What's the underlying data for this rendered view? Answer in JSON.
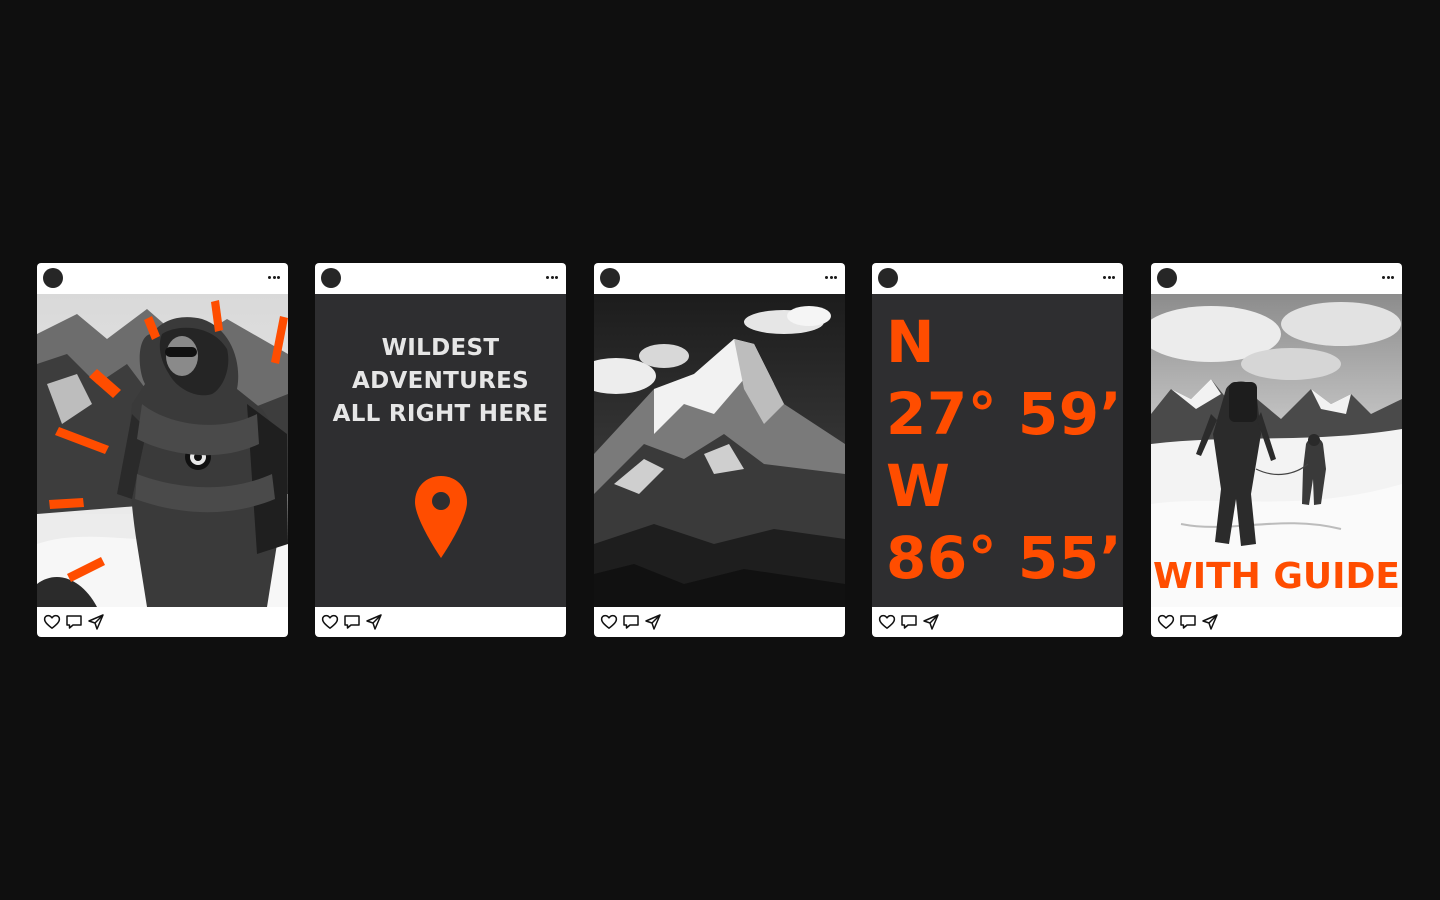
{
  "colors": {
    "background": "#0f0f0f",
    "accent": "#ff4d00",
    "panel": "#2e2e30",
    "card": "#ffffff"
  },
  "posts": [
    {
      "media": "photo-climber-in-hooded-parka",
      "icons": [
        "heart-icon",
        "comment-icon",
        "share-icon"
      ]
    },
    {
      "media": "text-card",
      "headline": [
        "WILDEST",
        "ADVENTURES",
        "ALL RIGHT HERE"
      ],
      "icon": "location-pin-icon",
      "icons": [
        "heart-icon",
        "comment-icon",
        "share-icon"
      ]
    },
    {
      "media": "photo-snowy-mountain-peak",
      "icons": [
        "heart-icon",
        "comment-icon",
        "share-icon"
      ]
    },
    {
      "media": "coordinates-card",
      "coords": [
        "N",
        "27° 59’",
        "W",
        "86° 55’"
      ],
      "icons": [
        "heart-icon",
        "comment-icon",
        "share-icon"
      ]
    },
    {
      "media": "photo-climbers-on-snow-ridge",
      "caption": "WITH GUIDE",
      "icons": [
        "heart-icon",
        "comment-icon",
        "share-icon"
      ]
    }
  ]
}
